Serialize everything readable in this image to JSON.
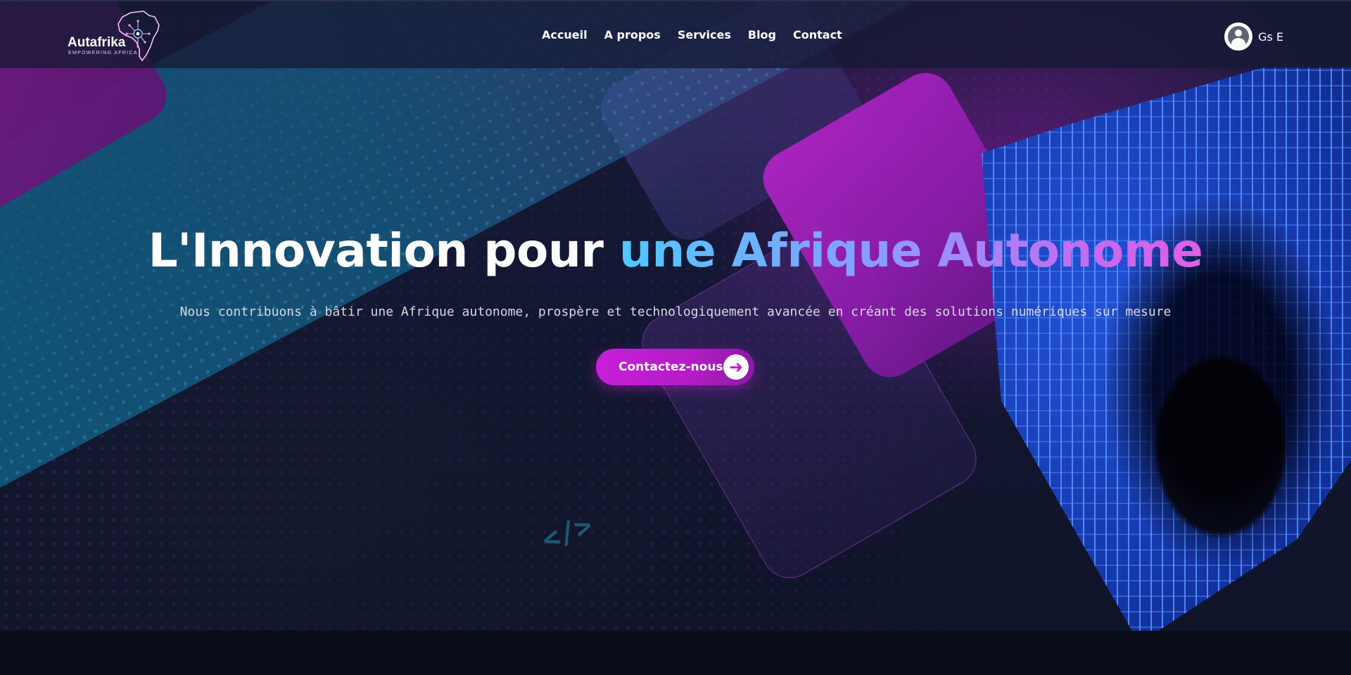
{
  "brand": {
    "name": "Autafrika",
    "tagline": "EMPOWERING AFRICA"
  },
  "nav": {
    "links": [
      "Accueil",
      "A propos",
      "Services",
      "Blog",
      "Contact"
    ]
  },
  "user": {
    "name": "Gs  E",
    "icon": "user-avatar-icon"
  },
  "hero": {
    "headline_plain": "L'Innovation pour ",
    "headline_highlight": "une Afrique Autonome",
    "subtitle": "Nous contribuons à bâtir une Afrique autonome, prospère et technologiquement avancée en créant des solutions numériques sur mesure",
    "cta_label": "Contactez-nous",
    "cta_icon": "arrow-right-icon",
    "code_icon": "</>"
  },
  "colors": {
    "accent": "#c81fd8",
    "gradient_start": "#4fc9ff",
    "gradient_end": "#e25ce8",
    "background": "#121733"
  }
}
